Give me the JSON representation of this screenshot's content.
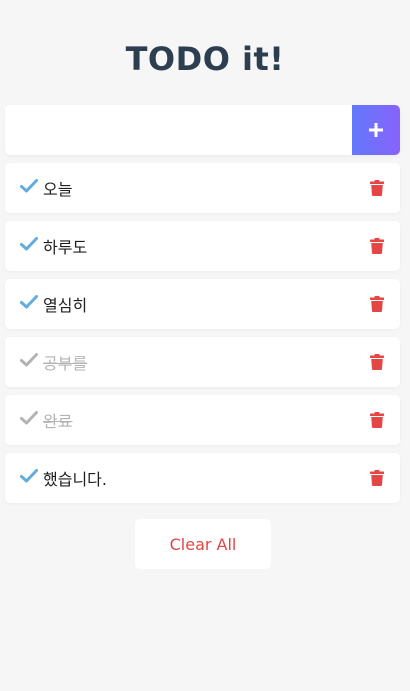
{
  "header": {
    "title": "TODO it!"
  },
  "input": {
    "value": "",
    "placeholder": ""
  },
  "add_button": {
    "icon": "plus-icon",
    "color_start": "#6478fb",
    "color_end": "#8763fb"
  },
  "todos": [
    {
      "text": "오늘",
      "completed": false
    },
    {
      "text": "하루도",
      "completed": false
    },
    {
      "text": "열심히",
      "completed": false
    },
    {
      "text": "공부를",
      "completed": true
    },
    {
      "text": "완료",
      "completed": true
    },
    {
      "text": "했습니다.",
      "completed": false
    }
  ],
  "icons": {
    "check": "check-icon",
    "delete": "trash-icon"
  },
  "colors": {
    "check_active": "#62acde",
    "check_done": "#b3b3b3",
    "trash": "#e44545",
    "title": "#2c3e50"
  },
  "footer": {
    "clear_label": "Clear All"
  }
}
